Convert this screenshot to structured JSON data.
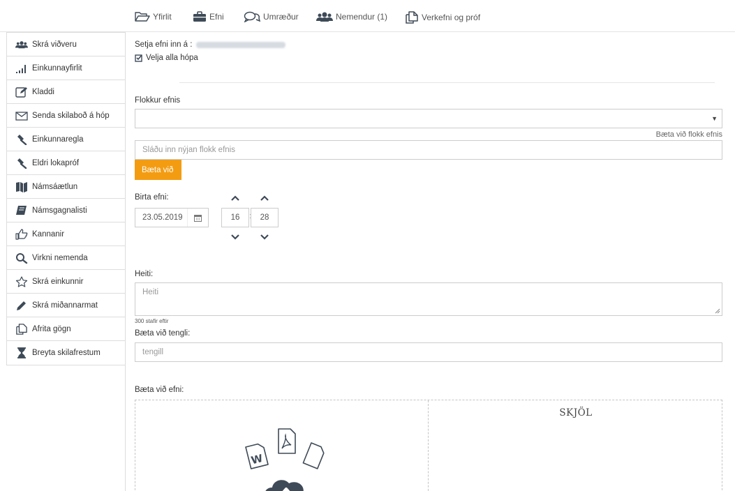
{
  "topnav": {
    "tabs": [
      {
        "label": "Yfirlit",
        "icon": "folder-open-icon"
      },
      {
        "label": "Efni",
        "icon": "briefcase-icon"
      },
      {
        "label": "Umræður",
        "icon": "comments-icon"
      },
      {
        "label": "Nemendur (1)",
        "icon": "users-icon"
      },
      {
        "label": "Verkefni og próf",
        "icon": "copy-icon"
      }
    ]
  },
  "sidebar": {
    "items": [
      {
        "label": "Skrá viðveru",
        "icon": "users-icon"
      },
      {
        "label": "Einkunnayfirlit",
        "icon": "signal-bars-icon"
      },
      {
        "label": "Kladdi",
        "icon": "edit-icon"
      },
      {
        "label": "Senda skilaboð á hóp",
        "icon": "envelope-icon"
      },
      {
        "label": "Einkunnaregla",
        "icon": "gavel-icon"
      },
      {
        "label": "Eldri lokapróf",
        "icon": "gavel-icon"
      },
      {
        "label": "Námsáætlun",
        "icon": "map-icon"
      },
      {
        "label": "Námsgagnalisti",
        "icon": "book-icon"
      },
      {
        "label": "Kannanir",
        "icon": "thumbs-up-icon"
      },
      {
        "label": "Virkni nemenda",
        "icon": "search-icon"
      },
      {
        "label": "Skrá einkunnir",
        "icon": "star-icon"
      },
      {
        "label": "Skrá miðannarmat",
        "icon": "pencil-icon"
      },
      {
        "label": "Afrita gögn",
        "icon": "copy-icon"
      },
      {
        "label": "Breyta skilafrestum",
        "icon": "hourglass-icon"
      }
    ]
  },
  "form": {
    "set_label": "Setja efni inn á :",
    "select_all_label": "Velja alla hópa",
    "category_label": "Flokkur efnis",
    "category_selected": "",
    "add_category_link": "Bæta við flokk efnis",
    "new_category_placeholder": "Sláðu inn nýjan flokk efnis",
    "add_button_label": "Bæta við",
    "publish_label": "Birta efni:",
    "publish_date": "23.05.2019",
    "publish_hour": "16",
    "publish_minute": "28",
    "time_separator": ":",
    "title_label": "Heiti:",
    "title_placeholder": "Heiti",
    "chars_left": "300 stafir eftir",
    "link_label": "Bæta við tengli:",
    "link_placeholder": "tengill",
    "content_label": "Bæta við efni:",
    "documents_heading": "SKJÖL"
  },
  "colors": {
    "accent_orange": "#f39c12",
    "icon_dark": "#3e4a57",
    "border": "#cccccc"
  }
}
